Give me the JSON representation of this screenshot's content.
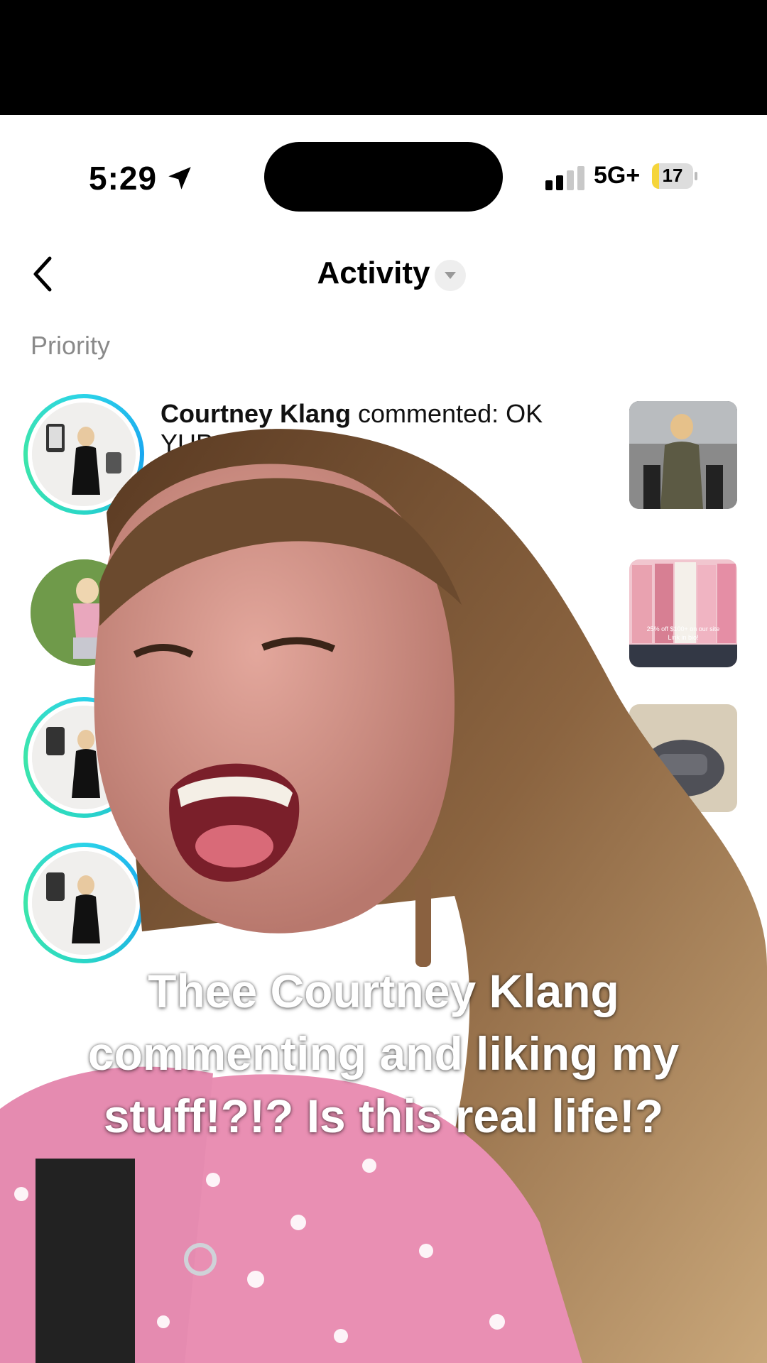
{
  "status_bar": {
    "time": "5:29",
    "network": "5G+",
    "battery": "17",
    "battery_level": 0.17
  },
  "header": {
    "title": "Activity"
  },
  "section": {
    "label": "Priority"
  },
  "rows": [
    {
      "name": "Courtney Klang",
      "text": " commented: OK",
      "text_line2": "YUP"
    }
  ],
  "caption": {
    "line1": "Thee Courtney Klang",
    "line2": "commenting and liking my",
    "line3": "stuff!?!? Is this real life!?"
  },
  "thumb_text": {
    "promo": "25% off $100+ on our site",
    "link": "Link in bio!"
  },
  "colors": {
    "ring_start": "#2bd3e8",
    "ring_end": "#3de6a9",
    "heart": "#fe2c55",
    "battery_fill": "#f5d53b"
  }
}
